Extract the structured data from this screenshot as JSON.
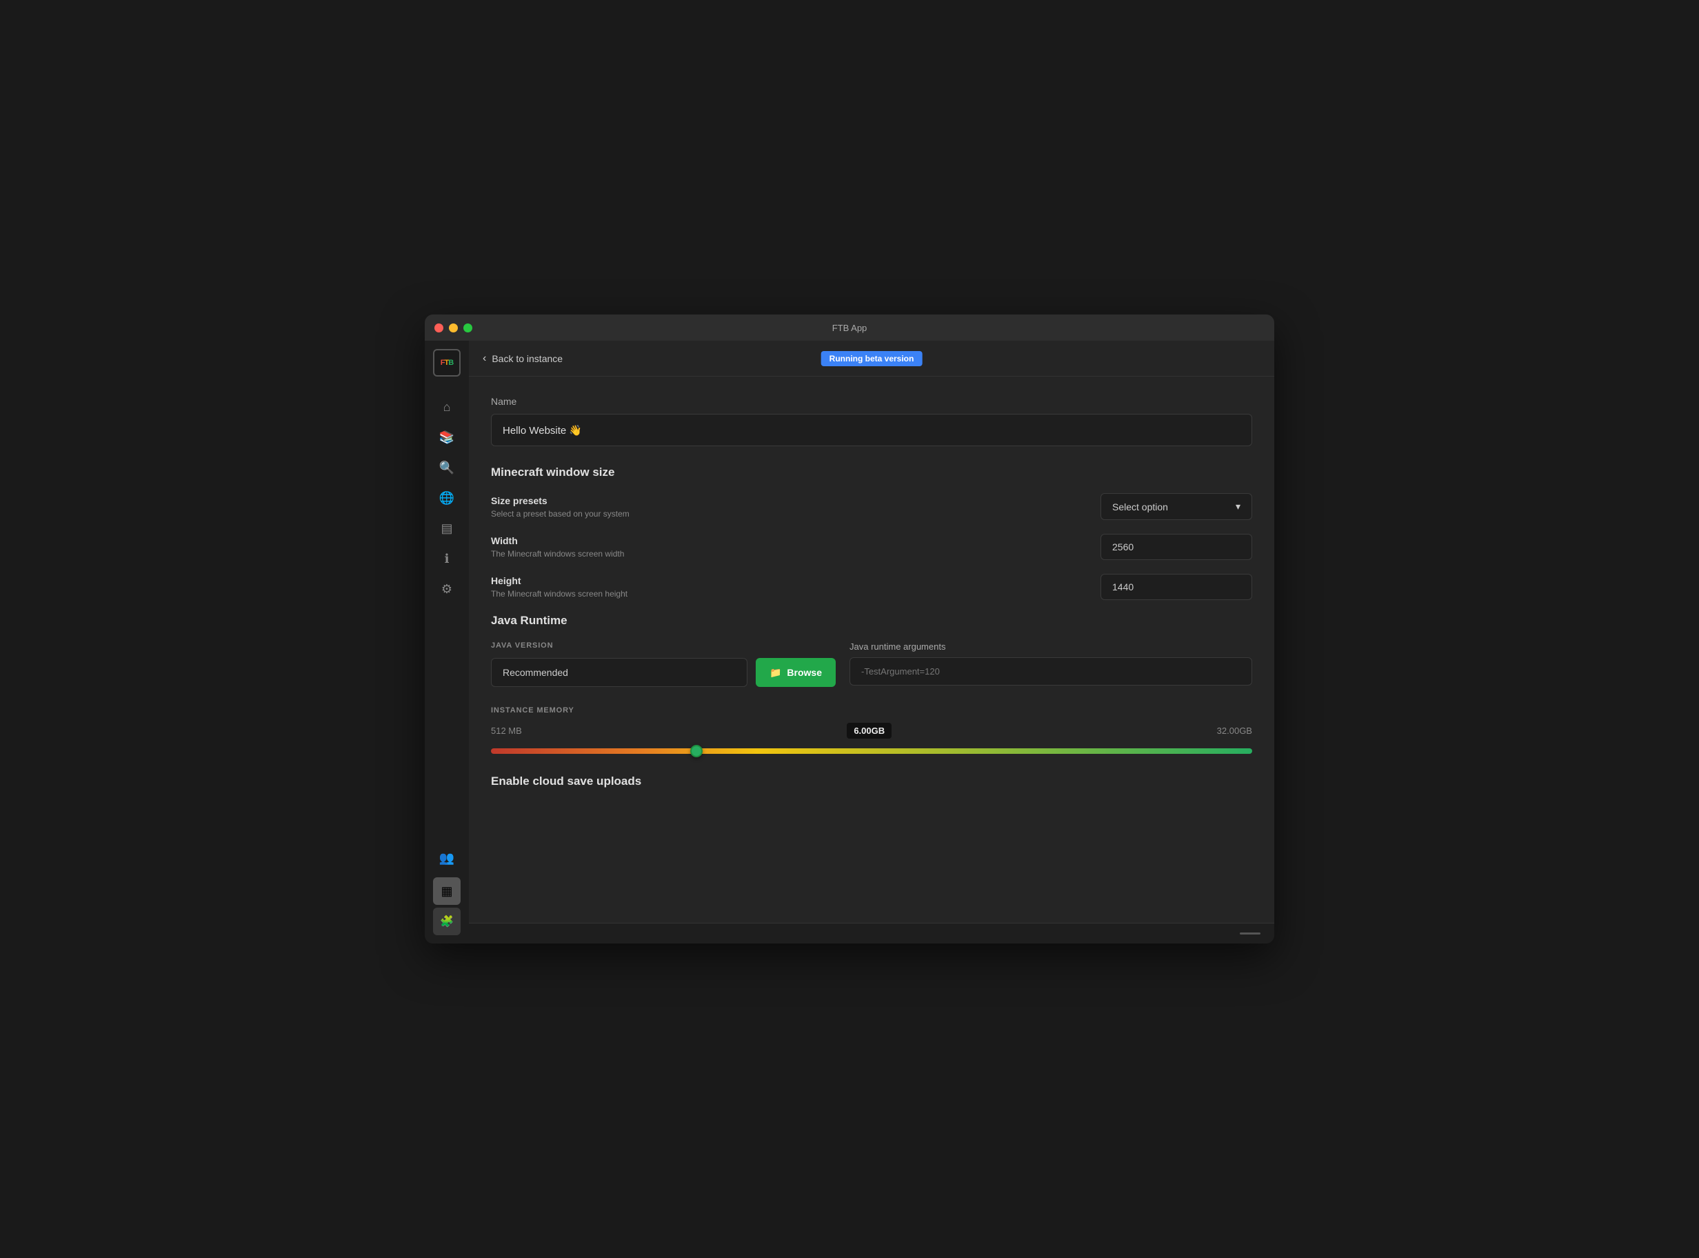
{
  "window": {
    "title": "FTB App"
  },
  "sidebar": {
    "logo": "FTB",
    "icons": [
      {
        "name": "home-icon",
        "symbol": "⌂"
      },
      {
        "name": "book-icon",
        "symbol": "📖"
      },
      {
        "name": "search-icon",
        "symbol": "🔍"
      },
      {
        "name": "globe-icon",
        "symbol": "🌐"
      },
      {
        "name": "list-icon",
        "symbol": "☰"
      },
      {
        "name": "info-icon",
        "symbol": "ℹ"
      },
      {
        "name": "settings-icon",
        "symbol": "⚙"
      }
    ],
    "bottom": {
      "users_icon": "👥",
      "avatar": "▦",
      "mod_icon": "🧩"
    }
  },
  "nav": {
    "back_label": "Back to instance",
    "beta_badge": "Running beta version"
  },
  "name_section": {
    "label": "Name",
    "value": "Hello Website 👋"
  },
  "window_size_section": {
    "title": "Minecraft window size",
    "size_presets": {
      "label": "Size presets",
      "desc": "Select a preset based on your system",
      "placeholder": "Select option"
    },
    "width": {
      "label": "Width",
      "desc": "The Minecraft windows screen width",
      "value": "2560"
    },
    "height": {
      "label": "Height",
      "desc": "The Minecraft windows screen height",
      "value": "1440"
    }
  },
  "java_section": {
    "title": "Java Runtime",
    "java_version": {
      "label": "JAVA VERSION",
      "value": "Recommended"
    },
    "browse_btn": "Browse",
    "java_args": {
      "label": "Java runtime arguments",
      "placeholder": "-TestArgument=120"
    }
  },
  "memory_section": {
    "label": "INSTANCE MEMORY",
    "min": "512 MB",
    "max": "32.00GB",
    "current": "6.00GB",
    "percent": 27
  },
  "cloud_save": {
    "title": "Enable cloud save uploads"
  }
}
